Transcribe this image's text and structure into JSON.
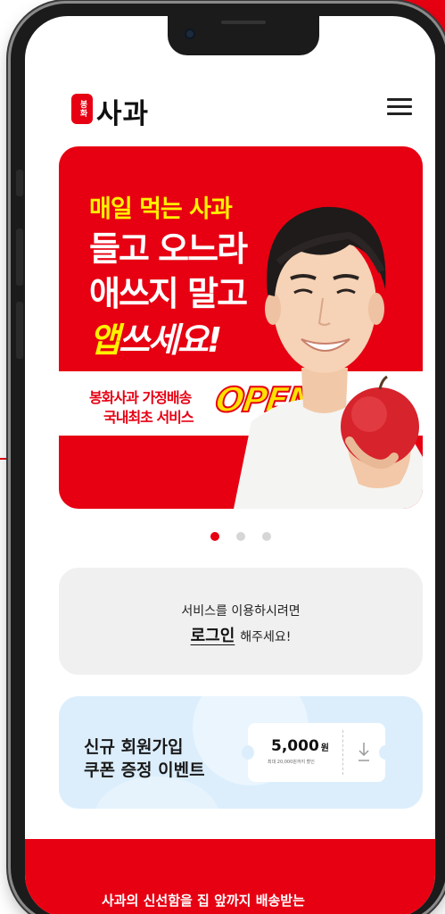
{
  "header": {
    "logo_seal": "봉화",
    "logo_text": "사과",
    "menu_icon": "hamburger-menu-icon"
  },
  "banner": {
    "line1": "매일 먹는 사과",
    "line2": "들고 오느라",
    "line3": "애쓰지 말고",
    "line4_accent": "앱",
    "line4_rest": "쓰세요!",
    "sub_line1": "봉화사과 가정배송",
    "sub_line2": "국내최초 서비스",
    "badge": "OPEN",
    "image": "model-holding-apple-photo"
  },
  "carousel": {
    "total": 3,
    "active_index": 0
  },
  "login_card": {
    "message": "서비스를 이용하시려면",
    "link_label": "로그인",
    "suffix": "해주세요!"
  },
  "coupon_card": {
    "title_line1": "신규 회원가입",
    "title_line2": "쿠폰 증정 이벤트",
    "amount": "5,000",
    "unit": "원",
    "note": "최대 20,000원까지 할인",
    "download_icon": "download-arrow-icon"
  },
  "bottom": {
    "text": "사과의 신선함을 집 앞까지 배송받는"
  },
  "colors": {
    "brand_red": "#e60012",
    "accent_yellow": "#fff200",
    "login_bg": "#f0f0f0",
    "coupon_bg": "#dceefc"
  }
}
